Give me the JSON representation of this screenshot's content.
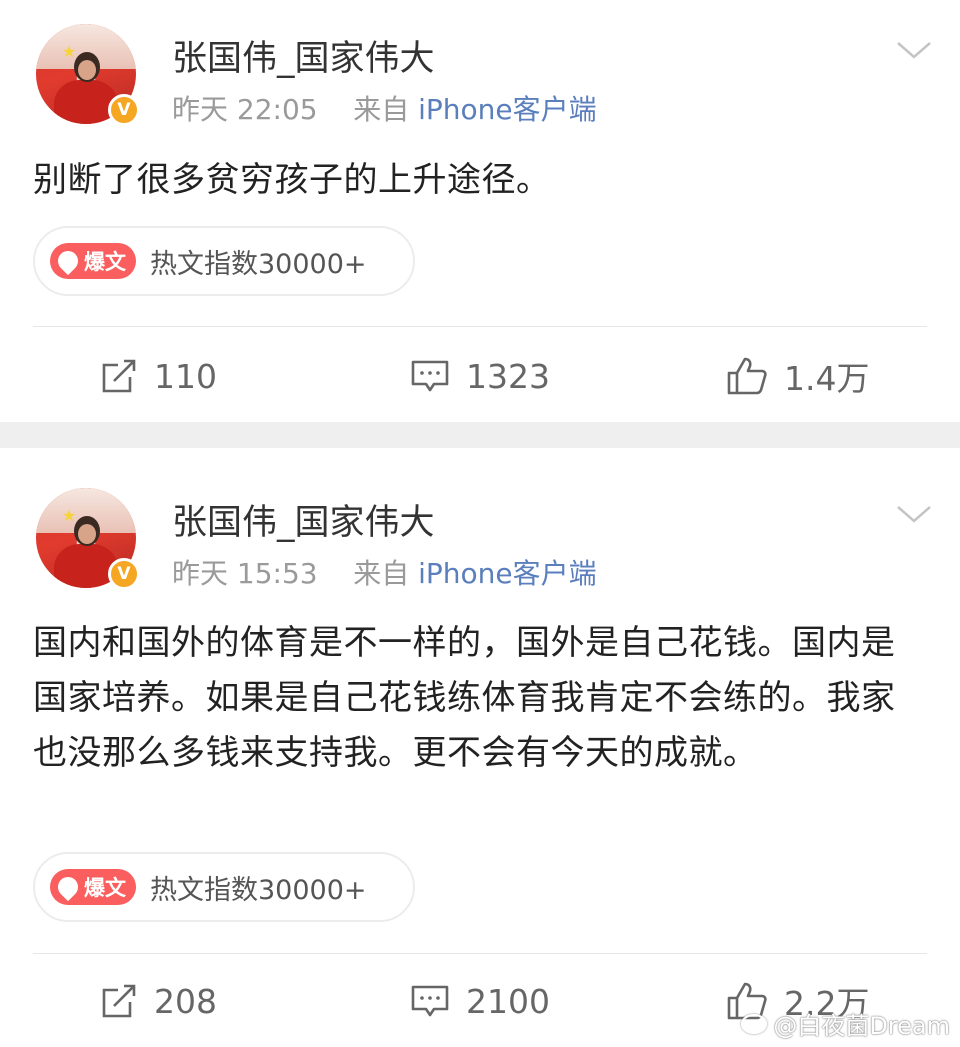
{
  "posts": [
    {
      "username": "张国伟_国家伟大",
      "time": "昨天 22:05",
      "source_prefix": "来自",
      "source": "iPhone客户端",
      "content": "别断了很多贫穷孩子的上升途径。",
      "hot_badge": "爆文",
      "hot_text": "热文指数30000+",
      "reposts": "110",
      "comments": "1323",
      "likes": "1.4万"
    },
    {
      "username": "张国伟_国家伟大",
      "time": "昨天 15:53",
      "source_prefix": "来自",
      "source": "iPhone客户端",
      "content": "国内和国外的体育是不一样的，国外是自己花钱。国内是国家培养。如果是自己花钱练体育我肯定不会练的。我家也没那么多钱来支持我。更不会有今天的成就。",
      "hot_badge": "爆文",
      "hot_text": "热文指数30000+",
      "reposts": "208",
      "comments": "2100",
      "likes": "2.2万"
    }
  ],
  "watermark": "@白夜菌Dream",
  "colors": {
    "verified": "#f5a623",
    "hot_badge": "#fa5e5e",
    "source_link": "#5b7fbd",
    "separator": "#efefef"
  }
}
